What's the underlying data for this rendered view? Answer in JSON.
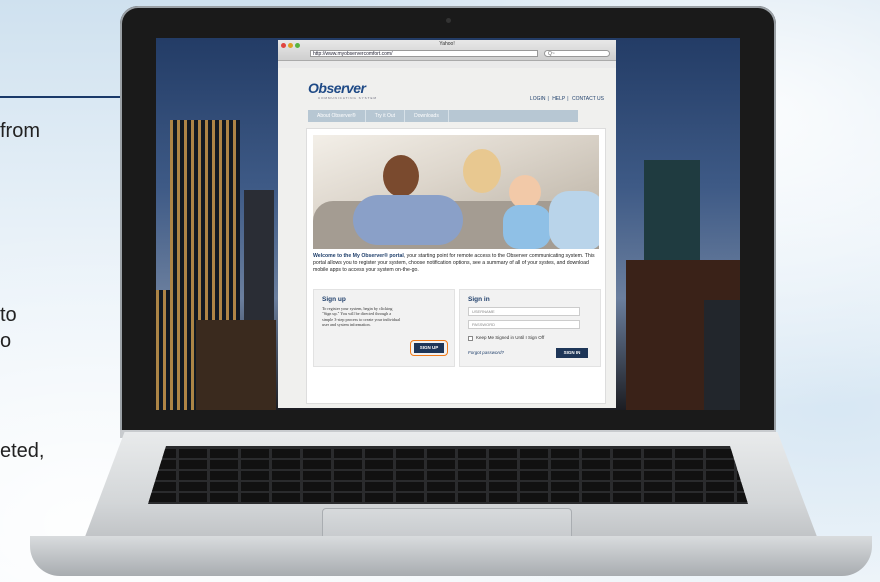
{
  "background": {
    "fragments": [
      "from",
      "to",
      "o",
      "eted,"
    ]
  },
  "browser": {
    "window_title": "Yahoo!",
    "url": "http://www.myobservercomfort.com/",
    "search_placeholder": "Q~"
  },
  "site": {
    "logo": "Observer",
    "logo_tagline": "COMMUNICATING SYSTEM",
    "top_links": [
      "LOGIN",
      "HELP",
      "CONTACT US"
    ],
    "nav_tabs": [
      "About Observer®",
      "Try it Out",
      "Downloads"
    ],
    "welcome_lead": "Welcome to the My Observer® portal",
    "welcome_text": ", your starting point for remote access to the Observer communicating system. This portal allows you to register your system, choose notification options, see a summary of all of your systes, and download mobile apps to access your system on-the-go."
  },
  "signup": {
    "heading": "Sign up",
    "text": "To register your system, begin by clicking \"Sign up.\" You will be directed through a simple 3-step process to create your individual user and system information.",
    "button": "SIGN UP"
  },
  "signin": {
    "heading": "Sign in",
    "username_placeholder": "USERNAME",
    "password_placeholder": "PASSWORD",
    "keep_signed_in": "Keep Me Signed in Until I Sign Off",
    "forgot": "Forgot password?",
    "button": "SIGN IN"
  },
  "colors": {
    "brand_blue": "#1f4a86",
    "button_navy": "#1e3658",
    "highlight_orange": "#f07a18"
  }
}
